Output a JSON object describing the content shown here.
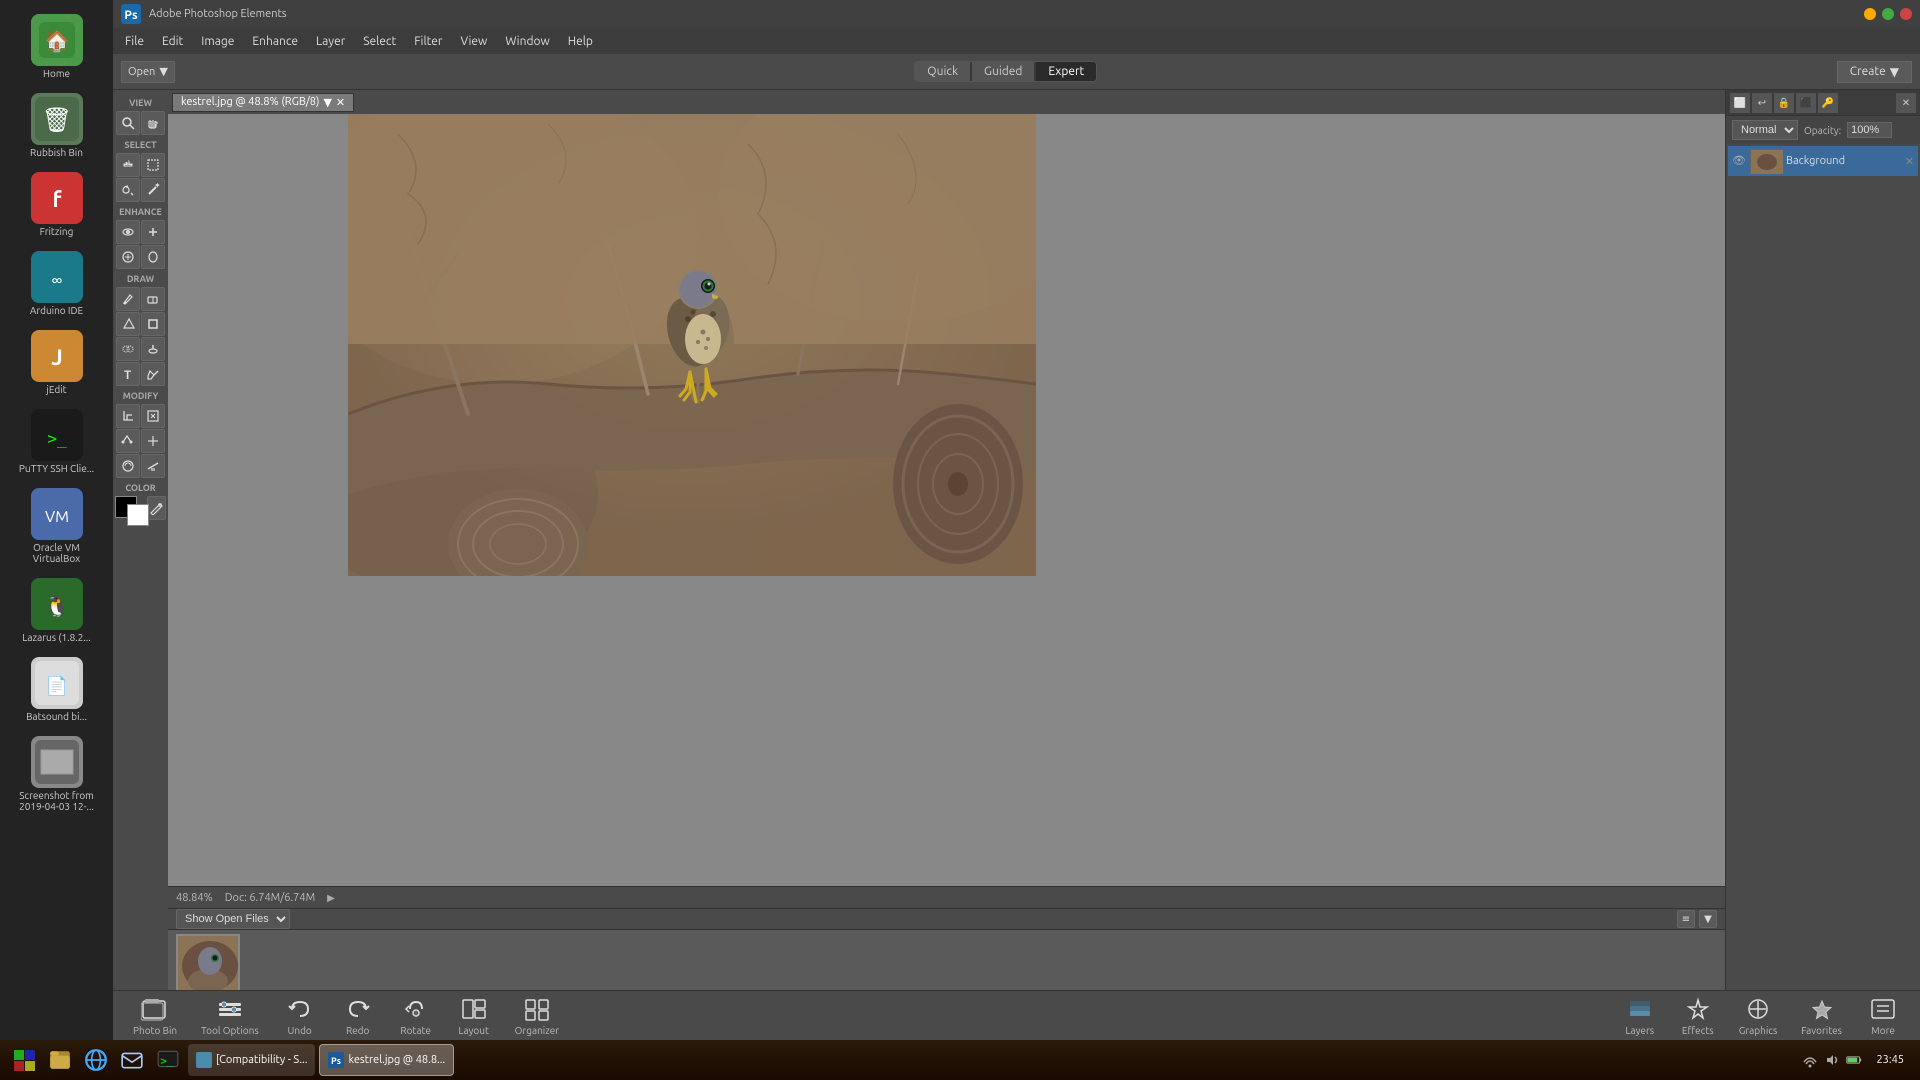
{
  "app": {
    "title": "Adobe Photoshop Elements",
    "tab_label": "kestrel.jpg @ 48.8% (RGB/8)"
  },
  "menu": {
    "items": [
      "File",
      "Edit",
      "Image",
      "Enhance",
      "Layer",
      "Select",
      "Filter",
      "View",
      "Window",
      "Help"
    ]
  },
  "toolbar": {
    "open_label": "Open",
    "quick_label": "Quick",
    "guided_label": "Guided",
    "expert_label": "Expert",
    "create_label": "Create"
  },
  "view_section": {
    "label": "VIEW"
  },
  "select_section": {
    "label": "SELECT"
  },
  "enhance_section": {
    "label": "ENHANCE"
  },
  "draw_section": {
    "label": "DRAW"
  },
  "modify_section": {
    "label": "MODIFY"
  },
  "color_section": {
    "label": "COLOR"
  },
  "status": {
    "zoom": "48.84%",
    "doc": "Doc: 6.74M/6.74M"
  },
  "photo_bin": {
    "show_open_label": "Show Open Files",
    "icon_label": "Photo Bin"
  },
  "layers": {
    "blend_mode": "Normal",
    "opacity_label": "Opacity:",
    "opacity_value": "100%",
    "layer_name": "Background"
  },
  "bottom_tools": [
    {
      "id": "photo-bin",
      "label": "Photo Bin",
      "icon": "🖼"
    },
    {
      "id": "tool-options",
      "label": "Tool Options",
      "icon": "⚙"
    },
    {
      "id": "undo",
      "label": "Undo",
      "icon": "↩"
    },
    {
      "id": "redo",
      "label": "Redo",
      "icon": "↪"
    },
    {
      "id": "rotate",
      "label": "Rotate",
      "icon": "↻"
    },
    {
      "id": "layout",
      "label": "Layout",
      "icon": "⊞"
    },
    {
      "id": "organizer",
      "label": "Organizer",
      "icon": "📋"
    },
    {
      "id": "layers",
      "label": "Layers",
      "icon": "▨"
    },
    {
      "id": "effects",
      "label": "Effects",
      "icon": "✨"
    },
    {
      "id": "graphics",
      "label": "Graphics",
      "icon": "+"
    },
    {
      "id": "favorites",
      "label": "Favorites",
      "icon": "★"
    },
    {
      "id": "more",
      "label": "More",
      "icon": "≡"
    }
  ],
  "dock_items": [
    {
      "id": "home",
      "label": "Home",
      "color": "#4a9a4a"
    },
    {
      "id": "rubbish-bin",
      "label": "Rubbish Bin",
      "color": "#6a8a6a"
    },
    {
      "id": "fritzing",
      "label": "Fritzing",
      "color": "#cc3333"
    },
    {
      "id": "arduino",
      "label": "Arduino IDE",
      "color": "#1a7a8a"
    },
    {
      "id": "jedit",
      "label": "jEdit",
      "color": "#cc8833"
    },
    {
      "id": "putty",
      "label": "PuTTY SSH Clie...",
      "color": "#333333"
    },
    {
      "id": "oracle-vm",
      "label": "Oracle VM VirtualBox",
      "color": "#4a6aaa"
    },
    {
      "id": "lazarus",
      "label": "Lazarus (1.8.2...",
      "color": "#2a6a2a"
    },
    {
      "id": "batsound",
      "label": "Batsound bi...",
      "color": "#cccccc"
    },
    {
      "id": "screenshot",
      "label": "Screenshot from 2019-04-03 12-...",
      "color": "#888888"
    }
  ],
  "taskbar": {
    "apps": [
      {
        "label": "[Compatibility - S...",
        "active": false
      },
      {
        "label": "kestrel.jpg @ 48.8...",
        "active": true
      }
    ],
    "clock": "23:45"
  }
}
